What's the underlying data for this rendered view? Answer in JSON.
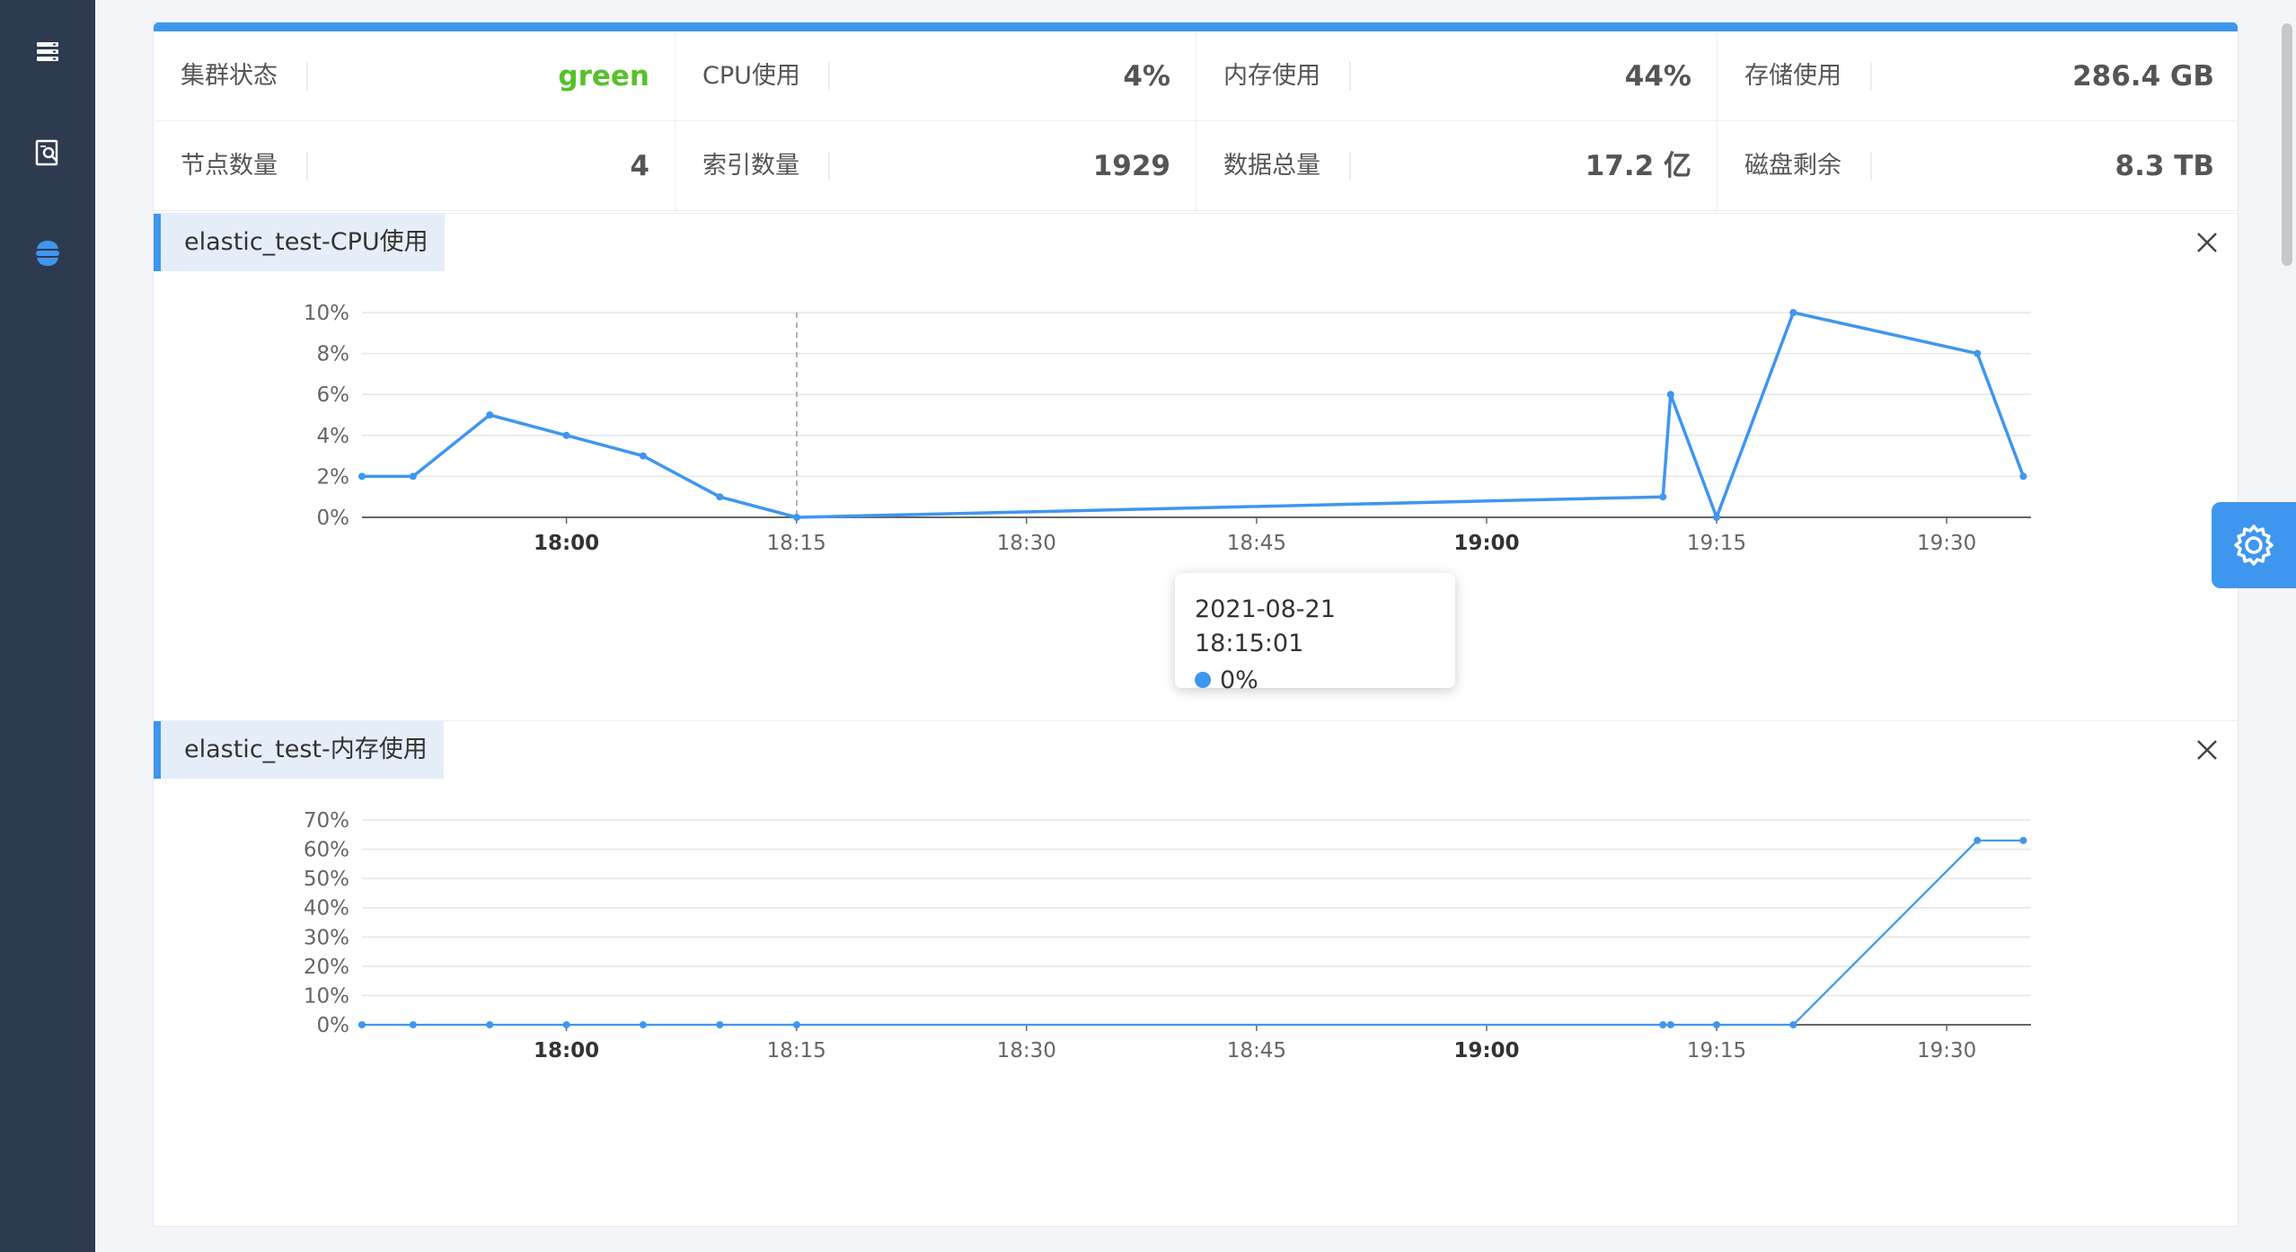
{
  "sidebar": {
    "items": [
      {
        "icon": "server-list-icon"
      },
      {
        "icon": "search-document-icon"
      },
      {
        "icon": "elastic-icon",
        "active": true
      }
    ]
  },
  "stats": [
    {
      "label": "集群状态",
      "value": "green",
      "status": "ok"
    },
    {
      "label": "CPU使用",
      "value": "4%"
    },
    {
      "label": "内存使用",
      "value": "44%"
    },
    {
      "label": "存储使用",
      "value": "286.4 GB"
    },
    {
      "label": "节点数量",
      "value": "4"
    },
    {
      "label": "索引数量",
      "value": "1929"
    },
    {
      "label": "数据总量",
      "value": "17.2 亿"
    },
    {
      "label": "磁盘剩余",
      "value": "8.3 TB"
    }
  ],
  "colors": {
    "accent": "#3f96ee",
    "status_ok": "#56c12a",
    "sidebar": "#2e3a4f"
  },
  "tooltip": {
    "title": "2021-08-21 18:15:01",
    "value": "0%"
  },
  "chart_data": [
    {
      "type": "line",
      "title": "elastic_test-CPU使用",
      "xlabel": "",
      "ylabel": "",
      "x_ticks": [
        {
          "label": "18:00",
          "t": 60,
          "bold": true
        },
        {
          "label": "18:15",
          "t": 75,
          "bold": false
        },
        {
          "label": "18:30",
          "t": 90,
          "bold": false
        },
        {
          "label": "18:45",
          "t": 105,
          "bold": false
        },
        {
          "label": "19:00",
          "t": 120,
          "bold": true
        },
        {
          "label": "19:15",
          "t": 135,
          "bold": false
        },
        {
          "label": "19:30",
          "t": 150,
          "bold": false
        }
      ],
      "x_range_minutes_from_17": [
        46.7,
        155.1
      ],
      "y_ticks": [
        "0%",
        "2%",
        "4%",
        "6%",
        "8%",
        "10%"
      ],
      "ylim": [
        0,
        10
      ],
      "series": [
        {
          "x": [
            46.7,
            50.0,
            55.0,
            60.0,
            65.0,
            70.0,
            75.0,
            141.9,
            142.4,
            145.0,
            150.0,
            155.1,
            155.1
          ],
          "y_note": "",
          "points": [
            [
              "17:46:40",
              2
            ],
            [
              "17:50",
              2
            ],
            [
              "17:55",
              5
            ],
            [
              "18:00",
              4
            ],
            [
              "18:05",
              3
            ],
            [
              "18:10",
              1
            ],
            [
              "18:15:01",
              0
            ],
            [
              "19:11:30",
              1
            ],
            [
              "19:12",
              6
            ],
            [
              "19:15",
              0
            ],
            [
              "19:20",
              10
            ],
            [
              "19:32",
              8
            ],
            [
              "19:35",
              2
            ]
          ]
        }
      ],
      "hover_x": "18:15:01"
    },
    {
      "type": "line",
      "title": "elastic_test-内存使用",
      "xlabel": "",
      "ylabel": "",
      "x_ticks": [
        {
          "label": "18:00",
          "t": 60,
          "bold": true
        },
        {
          "label": "18:15",
          "t": 75,
          "bold": false
        },
        {
          "label": "18:30",
          "t": 90,
          "bold": false
        },
        {
          "label": "18:45",
          "t": 105,
          "bold": false
        },
        {
          "label": "19:00",
          "t": 120,
          "bold": true
        },
        {
          "label": "19:15",
          "t": 135,
          "bold": false
        },
        {
          "label": "19:30",
          "t": 150,
          "bold": false
        }
      ],
      "y_ticks": [
        "0%",
        "10%",
        "20%",
        "30%",
        "40%",
        "50%",
        "60%",
        "70%"
      ],
      "ylim": [
        0,
        70
      ],
      "series": [
        {
          "points": [
            [
              "17:46:40",
              0
            ],
            [
              "17:50",
              0
            ],
            [
              "17:55",
              0
            ],
            [
              "18:00",
              0
            ],
            [
              "18:05",
              0
            ],
            [
              "18:10",
              0
            ],
            [
              "18:15:01",
              0
            ],
            [
              "19:11:30",
              0
            ],
            [
              "19:12",
              0
            ],
            [
              "19:15",
              0
            ],
            [
              "19:20",
              0
            ],
            [
              "19:32",
              63
            ],
            [
              "19:35",
              63
            ]
          ]
        }
      ]
    }
  ]
}
